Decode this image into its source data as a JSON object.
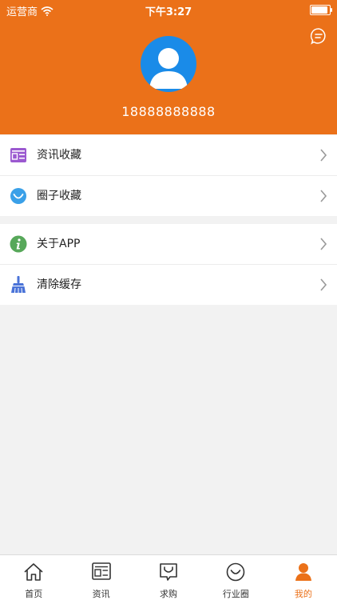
{
  "status_bar": {
    "carrier": "运营商",
    "time": "下午3:27"
  },
  "profile": {
    "phone": "18888888888"
  },
  "menu_group_1": [
    {
      "label": "资讯收藏",
      "icon": "news-card-icon"
    },
    {
      "label": "圈子收藏",
      "icon": "circle-smile-icon"
    }
  ],
  "menu_group_2": [
    {
      "label": "关于APP",
      "icon": "info-icon"
    },
    {
      "label": "清除缓存",
      "icon": "broom-icon"
    }
  ],
  "tabbar": [
    {
      "label": "首页",
      "icon": "home-icon"
    },
    {
      "label": "资讯",
      "icon": "news-icon"
    },
    {
      "label": "求购",
      "icon": "bag-icon"
    },
    {
      "label": "行业圈",
      "icon": "circle-icon"
    },
    {
      "label": "我的",
      "icon": "person-icon",
      "active": true
    }
  ],
  "colors": {
    "accent": "#eb7119",
    "avatar": "#1a8be8"
  }
}
